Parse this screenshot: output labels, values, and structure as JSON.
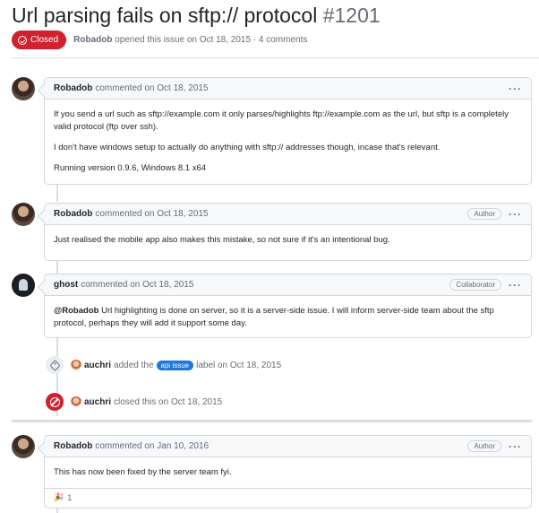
{
  "issue": {
    "title": "Url parsing fails on sftp:// protocol",
    "number": "#1201",
    "state": "Closed",
    "author": "Robadob",
    "opened_text": "opened this issue on Oct 18, 2015 · 4 comments"
  },
  "comments": [
    {
      "author": "Robadob",
      "meta": "commented on Oct 18, 2015",
      "role": "",
      "paragraphs": [
        "If you send a url such as sftp://example.com it only parses/highlights ftp://example.com as the url, but sftp is a completely valid protocol (ftp over ssh).",
        "I don't have windows setup to actually do anything with sftp:// addresses though, incase that's relevant.",
        "Running version 0.9.6, Windows 8.1 x64"
      ]
    },
    {
      "author": "Robadob",
      "meta": "commented on Oct 18, 2015",
      "role": "Author",
      "paragraphs": [
        "Just realised the mobile app also makes this mistake, so not sure if it's an intentional bug."
      ]
    },
    {
      "author": "ghost",
      "meta": "commented on Oct 18, 2015",
      "role": "Collaborator",
      "mention": "@Robadob",
      "paragraphs": [
        " Url highlighting is done on server, so it is a server-side issue. I will inform server-side team about the sftp protocol, perhaps they will add it support some day."
      ]
    },
    {
      "author": "Robadob",
      "meta": "commented on Jan 10, 2016",
      "role": "Author",
      "paragraphs": [
        "This has now been fixed by the server team fyi."
      ],
      "reaction_count": "1"
    }
  ],
  "events": [
    {
      "actor": "auchri",
      "before": "added the",
      "label": "api issue",
      "after": "label on Oct 18, 2015"
    },
    {
      "actor": "auchri",
      "text": "closed this on Oct 18, 2015"
    }
  ],
  "icons": {
    "state": "issue-closed-icon",
    "menu": "kebab-horizontal-icon",
    "tag": "tag-icon",
    "closed_event": "circle-slash-icon",
    "reaction": "party-popper-icon"
  },
  "colors": {
    "closed_red": "#cf222e",
    "label_blue": "#1d76db",
    "border": "#d0d7de",
    "header_bg": "#f6f8fa",
    "muted": "#656d76"
  }
}
